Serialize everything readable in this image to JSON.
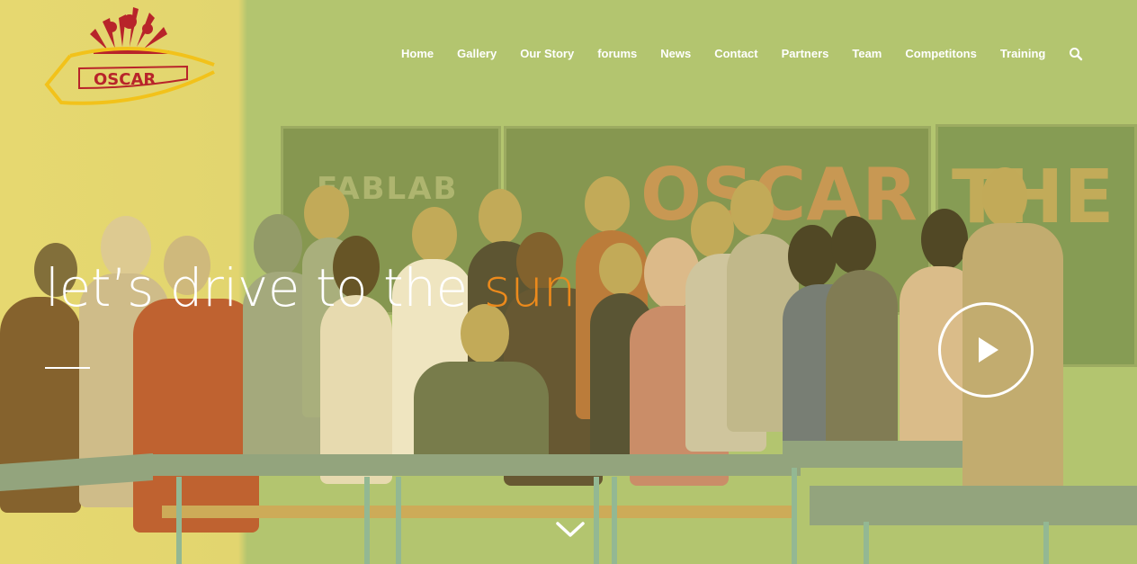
{
  "brand": {
    "logo_text": "OSCAR",
    "logo_name": "oscar-sunburst-logo"
  },
  "nav": {
    "items": [
      {
        "label": "Home"
      },
      {
        "label": "Gallery"
      },
      {
        "label": "Our Story"
      },
      {
        "label": "forums"
      },
      {
        "label": "News"
      },
      {
        "label": "Contact"
      },
      {
        "label": "Partners"
      },
      {
        "label": "Team"
      },
      {
        "label": "Competitons"
      },
      {
        "label": "Training"
      }
    ],
    "search_icon": "search-icon"
  },
  "hero": {
    "headline_main": "let’s drive to the ",
    "headline_accent": "sun",
    "accent_color": "#ec8a1c",
    "play_icon": "play-icon",
    "scroll_icon": "chevron-down-icon",
    "board_texts": [
      "FABLAB",
      "OSCAR",
      "THE"
    ]
  }
}
